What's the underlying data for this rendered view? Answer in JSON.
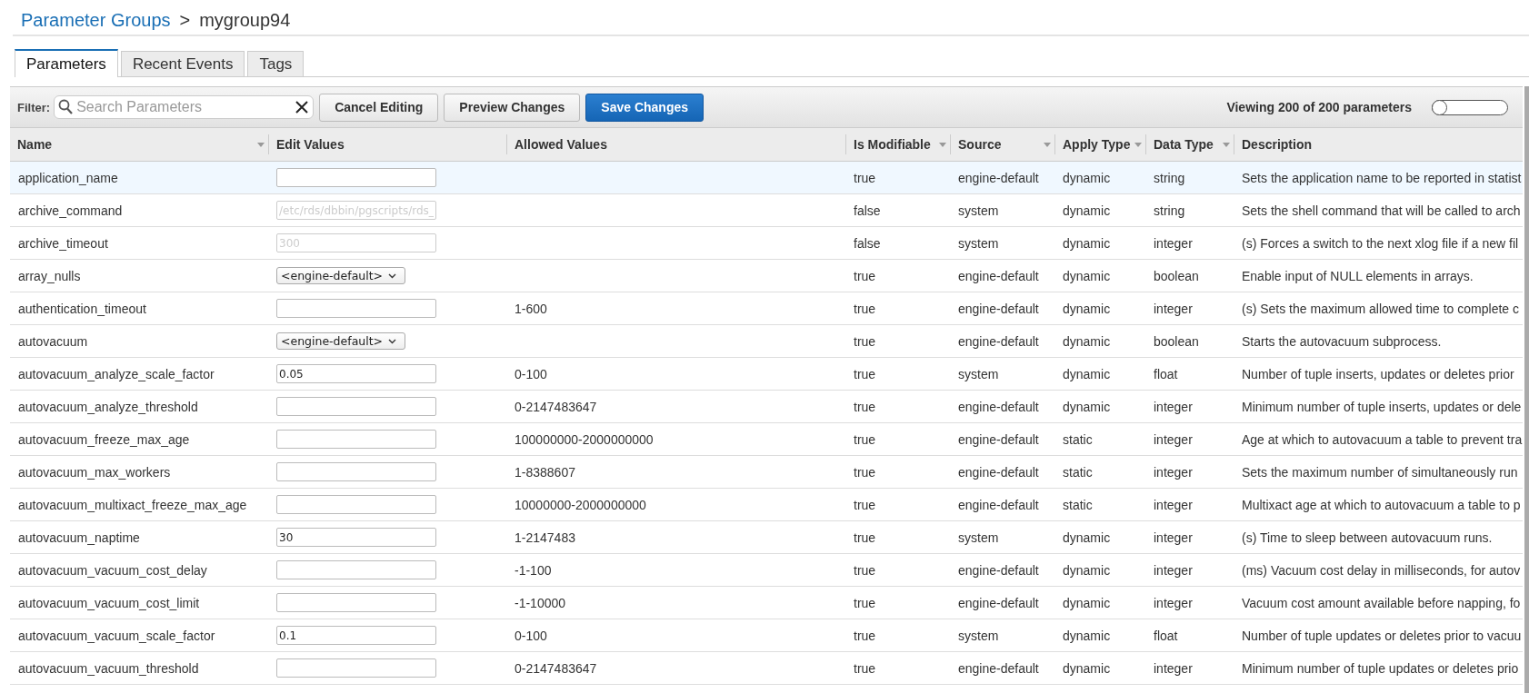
{
  "breadcrumb": {
    "parent": "Parameter Groups",
    "separator": ">",
    "current": "mygroup94"
  },
  "tabs": [
    {
      "label": "Parameters",
      "selected": true
    },
    {
      "label": "Recent Events",
      "selected": false
    },
    {
      "label": "Tags",
      "selected": false
    }
  ],
  "toolbar": {
    "filter_label": "Filter:",
    "search": {
      "placeholder": "Search Parameters"
    },
    "buttons": [
      {
        "label": "Cancel Editing",
        "primary": false
      },
      {
        "label": "Preview Changes",
        "primary": false
      },
      {
        "label": "Save Changes",
        "primary": true
      }
    ],
    "count": "Viewing 200 of 200 parameters",
    "toggle": {
      "on": false
    }
  },
  "table": {
    "columns": [
      {
        "label": "Name",
        "sortable": true
      },
      {
        "label": "Edit Values",
        "sortable": false
      },
      {
        "label": "Allowed Values",
        "sortable": false
      },
      {
        "label": "Is Modifiable",
        "sortable": true
      },
      {
        "label": "Source",
        "sortable": true
      },
      {
        "label": "Apply Type",
        "sortable": true
      },
      {
        "label": "Data Type",
        "sortable": true
      },
      {
        "label": "Description",
        "sortable": false
      }
    ],
    "rows": [
      {
        "name": "application_name",
        "edit": {
          "kind": "input",
          "disabled": false
        },
        "allowed": "",
        "modifiable": "true",
        "source": "engine-default",
        "apply": "dynamic",
        "dtype": "string",
        "desc": "Sets the application name to be reported in statist",
        "selected": true
      },
      {
        "name": "archive_command",
        "edit": {
          "kind": "input",
          "disabled": true,
          "value": "/etc/rds/dbbin/pgscripts/rds_"
        },
        "allowed": "",
        "modifiable": "false",
        "source": "system",
        "apply": "dynamic",
        "dtype": "string",
        "desc": "Sets the shell command that will be called to arch",
        "selected": false
      },
      {
        "name": "archive_timeout",
        "edit": {
          "kind": "input",
          "disabled": true,
          "value": "300"
        },
        "allowed": "",
        "modifiable": "false",
        "source": "system",
        "apply": "dynamic",
        "dtype": "integer",
        "desc": "(s) Forces a switch to the next xlog file if a new fil",
        "selected": false
      },
      {
        "name": "array_nulls",
        "edit": {
          "kind": "select",
          "disabled": false,
          "value": "<engine-default>"
        },
        "allowed": "",
        "modifiable": "true",
        "source": "engine-default",
        "apply": "dynamic",
        "dtype": "boolean",
        "desc": "Enable input of NULL elements in arrays.",
        "selected": false
      },
      {
        "name": "authentication_timeout",
        "edit": {
          "kind": "input",
          "disabled": false
        },
        "allowed": "1-600",
        "modifiable": "true",
        "source": "engine-default",
        "apply": "dynamic",
        "dtype": "integer",
        "desc": "(s) Sets the maximum allowed time to complete c",
        "selected": false
      },
      {
        "name": "autovacuum",
        "edit": {
          "kind": "select",
          "disabled": false,
          "value": "<engine-default>"
        },
        "allowed": "",
        "modifiable": "true",
        "source": "engine-default",
        "apply": "dynamic",
        "dtype": "boolean",
        "desc": "Starts the autovacuum subprocess.",
        "selected": false
      },
      {
        "name": "autovacuum_analyze_scale_factor",
        "edit": {
          "kind": "input",
          "disabled": false,
          "value": "0.05"
        },
        "allowed": "0-100",
        "modifiable": "true",
        "source": "system",
        "apply": "dynamic",
        "dtype": "float",
        "desc": "Number of tuple inserts, updates or deletes prior",
        "selected": false
      },
      {
        "name": "autovacuum_analyze_threshold",
        "edit": {
          "kind": "input",
          "disabled": false
        },
        "allowed": "0-2147483647",
        "modifiable": "true",
        "source": "engine-default",
        "apply": "dynamic",
        "dtype": "integer",
        "desc": "Minimum number of tuple inserts, updates or dele",
        "selected": false
      },
      {
        "name": "autovacuum_freeze_max_age",
        "edit": {
          "kind": "input",
          "disabled": false
        },
        "allowed": "100000000-2000000000",
        "modifiable": "true",
        "source": "engine-default",
        "apply": "static",
        "dtype": "integer",
        "desc": "Age at which to autovacuum a table to prevent tra",
        "selected": false
      },
      {
        "name": "autovacuum_max_workers",
        "edit": {
          "kind": "input",
          "disabled": false
        },
        "allowed": "1-8388607",
        "modifiable": "true",
        "source": "engine-default",
        "apply": "static",
        "dtype": "integer",
        "desc": "Sets the maximum number of simultaneously run",
        "selected": false
      },
      {
        "name": "autovacuum_multixact_freeze_max_age",
        "edit": {
          "kind": "input",
          "disabled": false
        },
        "allowed": "10000000-2000000000",
        "modifiable": "true",
        "source": "engine-default",
        "apply": "static",
        "dtype": "integer",
        "desc": "Multixact age at which to autovacuum a table to p",
        "selected": false
      },
      {
        "name": "autovacuum_naptime",
        "edit": {
          "kind": "input",
          "disabled": false,
          "value": "30"
        },
        "allowed": "1-2147483",
        "modifiable": "true",
        "source": "system",
        "apply": "dynamic",
        "dtype": "integer",
        "desc": "(s) Time to sleep between autovacuum runs.",
        "selected": false
      },
      {
        "name": "autovacuum_vacuum_cost_delay",
        "edit": {
          "kind": "input",
          "disabled": false
        },
        "allowed": "-1-100",
        "modifiable": "true",
        "source": "engine-default",
        "apply": "dynamic",
        "dtype": "integer",
        "desc": "(ms) Vacuum cost delay in milliseconds, for autov",
        "selected": false
      },
      {
        "name": "autovacuum_vacuum_cost_limit",
        "edit": {
          "kind": "input",
          "disabled": false
        },
        "allowed": "-1-10000",
        "modifiable": "true",
        "source": "engine-default",
        "apply": "dynamic",
        "dtype": "integer",
        "desc": "Vacuum cost amount available before napping, fo",
        "selected": false
      },
      {
        "name": "autovacuum_vacuum_scale_factor",
        "edit": {
          "kind": "input",
          "disabled": false,
          "value": "0.1"
        },
        "allowed": "0-100",
        "modifiable": "true",
        "source": "system",
        "apply": "dynamic",
        "dtype": "float",
        "desc": "Number of tuple updates or deletes prior to vacuu",
        "selected": false
      },
      {
        "name": "autovacuum_vacuum_threshold",
        "edit": {
          "kind": "input",
          "disabled": false
        },
        "allowed": "0-2147483647",
        "modifiable": "true",
        "source": "engine-default",
        "apply": "dynamic",
        "dtype": "integer",
        "desc": "Minimum number of tuple updates or deletes prio",
        "selected": false
      }
    ]
  }
}
